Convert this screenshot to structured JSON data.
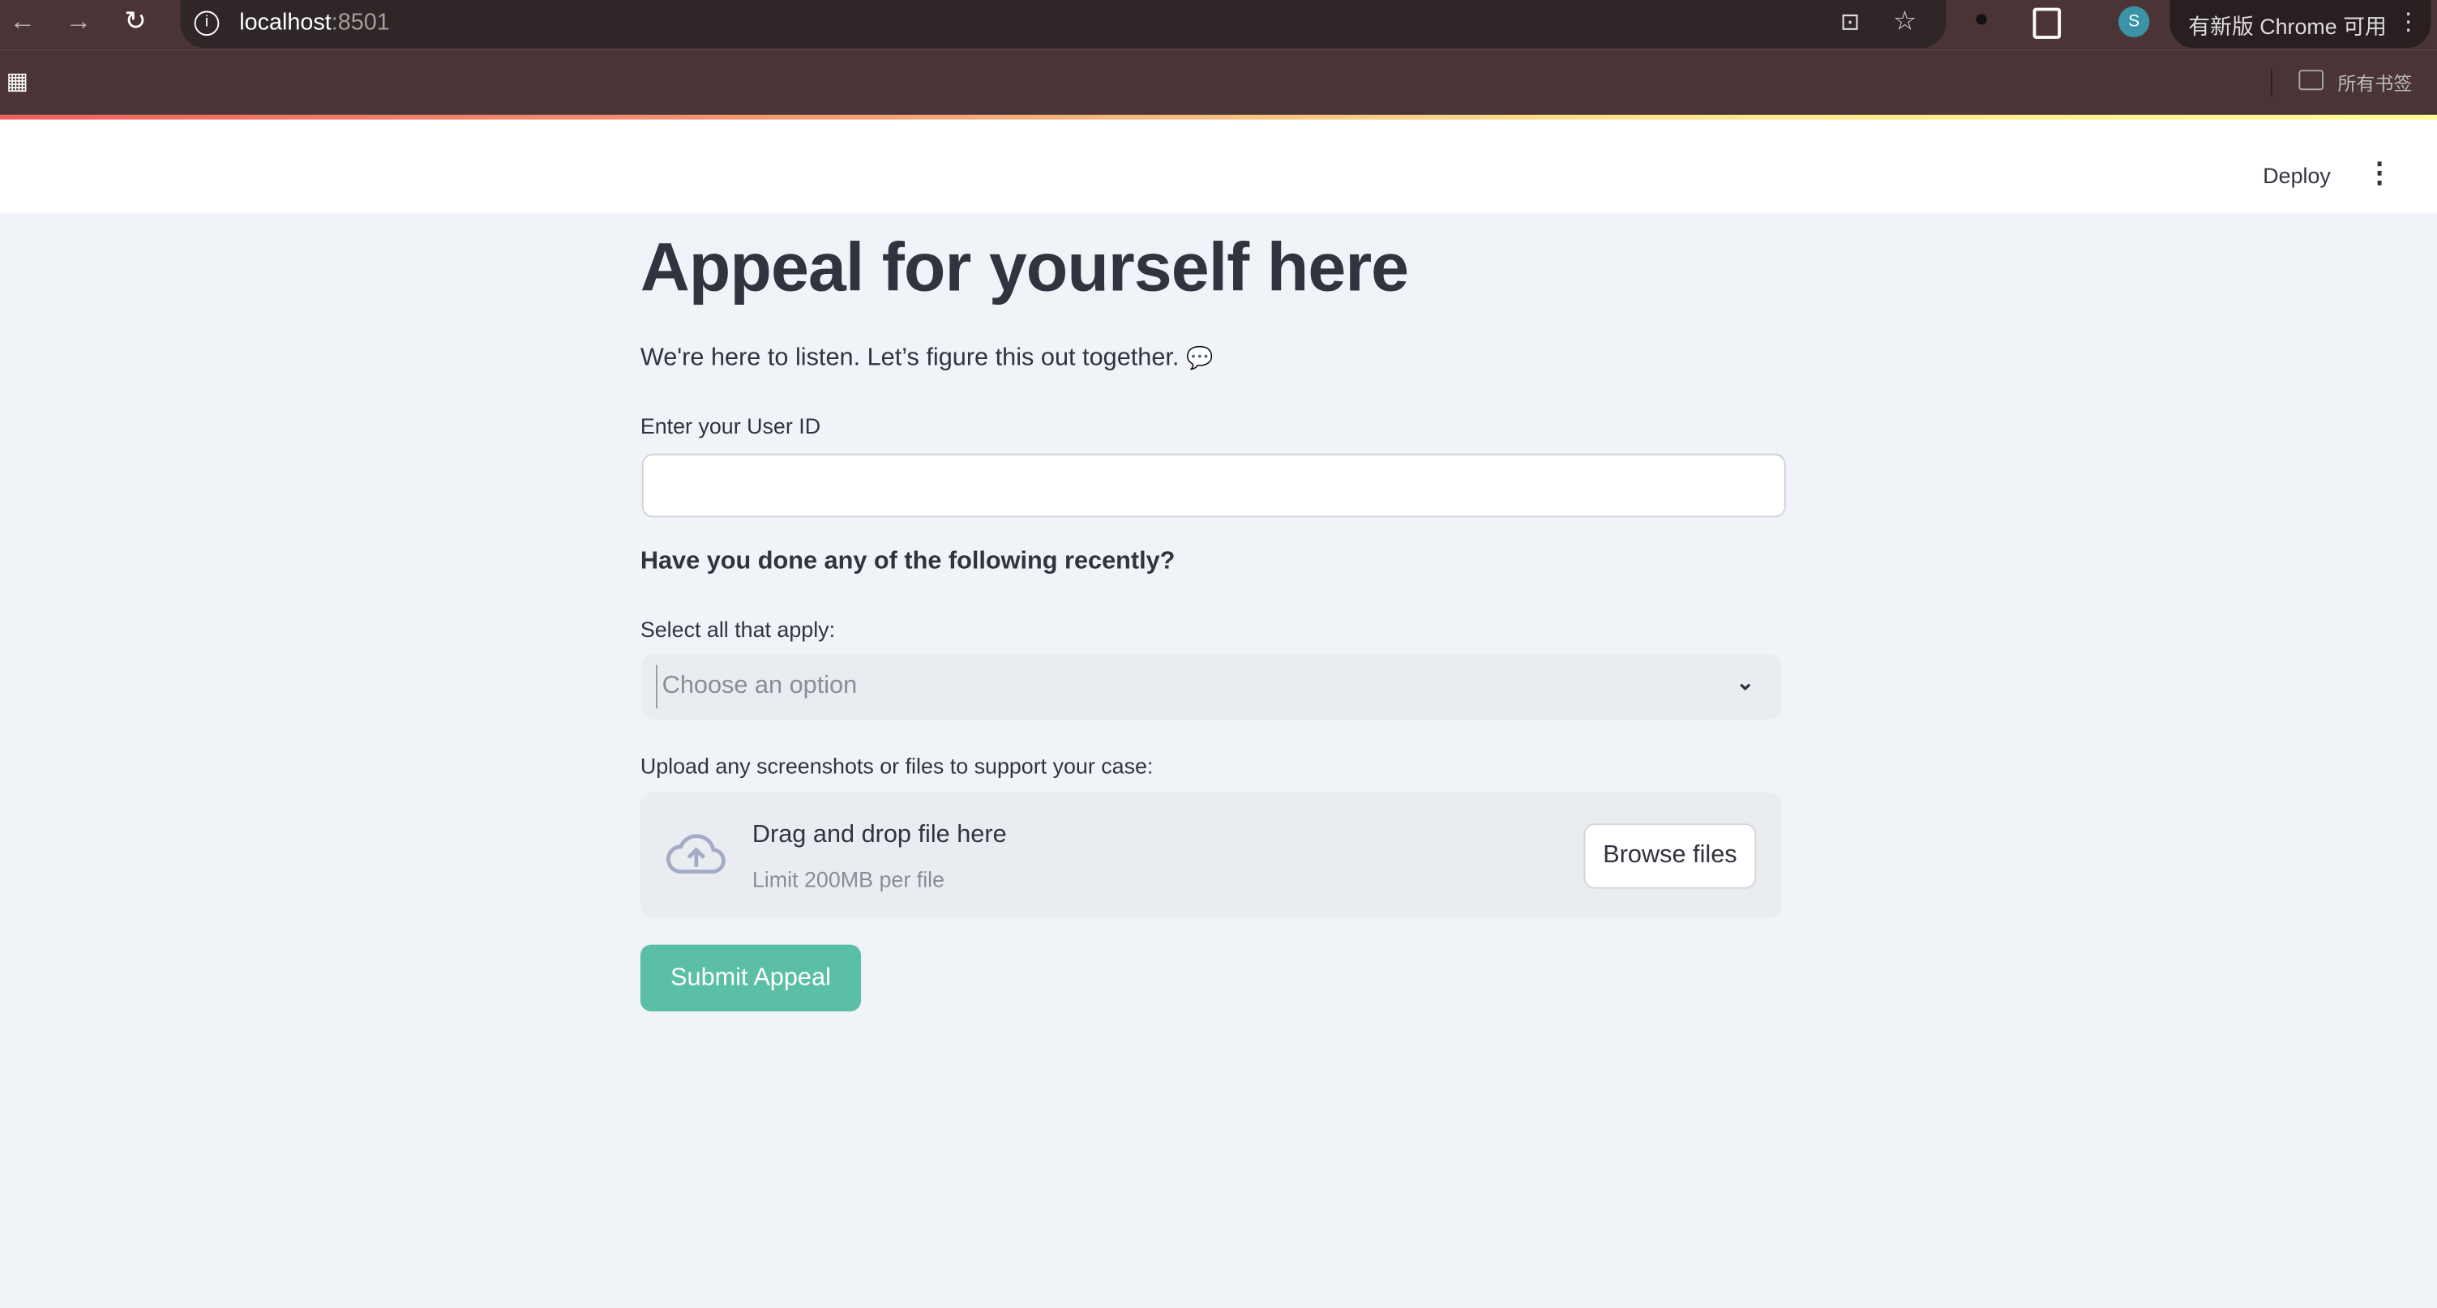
{
  "browser": {
    "url_host": "localhost",
    "url_port": ":8501",
    "update_label": "有新版 Chrome 可用",
    "profile_initial": "S",
    "bookmarks_label": "所有书签"
  },
  "header": {
    "deploy_label": "Deploy"
  },
  "main": {
    "title": "Appeal for yourself here",
    "subtitle": "We're here to listen. Let’s figure this out together.",
    "user_id_label": "Enter your User ID",
    "user_id_value": "",
    "question_heading": "Have you done any of the following recently?",
    "select_label": "Select all that apply:",
    "select_placeholder": "Choose an option",
    "upload_label": "Upload any screenshots or files to support your case:",
    "drop_text": "Drag and drop file here",
    "limit_text": "Limit 200MB per file",
    "browse_label": "Browse files",
    "submit_label": "Submit Appeal"
  },
  "colors": {
    "accent": "#5bbfa6",
    "background": "#f0f4f8",
    "text": "#31333f"
  }
}
